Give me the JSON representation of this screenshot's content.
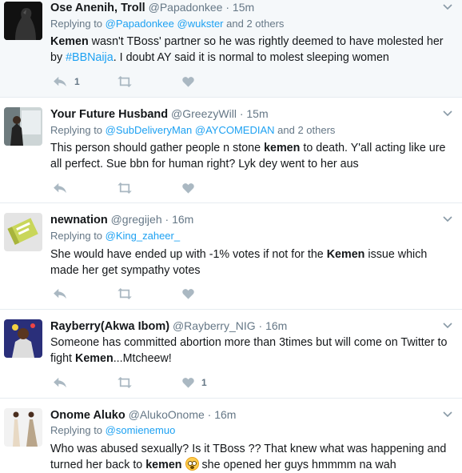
{
  "tweets": [
    {
      "name": "Ose Anenih, Troll",
      "handle": "@Papadonkee",
      "dot": "·",
      "time": "15m",
      "reply_prefix": "Replying to",
      "reply_users": [
        "@Papadonkee",
        "@wukster"
      ],
      "reply_suffix": "and 2 others",
      "text_kw": "Kemen",
      "text_a": " wasn't TBoss' partner so he was rightly deemed to have molested her by ",
      "text_tag": "#BBNaija",
      "text_b": ". I doubt AY said it is normal to molest sleeping women",
      "reply_count": "1",
      "like_count": ""
    },
    {
      "name": "Your Future Husband",
      "handle": "@GreezyWill",
      "dot": "·",
      "time": "15m",
      "reply_prefix": "Replying to",
      "reply_users": [
        "@SubDeliveryMan",
        "@AYCOMEDIAN"
      ],
      "reply_suffix": "and 2 others",
      "text_a": "This person should gather people n stone ",
      "text_kw": "kemen",
      "text_b": " to death. Y'all acting like ure all perfect. Sue bbn for human right? Lyk dey went to her aus"
    },
    {
      "name": "newnation",
      "handle": "@gregijeh",
      "dot": "·",
      "time": "16m",
      "reply_prefix": "Replying to",
      "reply_users": [
        "@King_zaheer_"
      ],
      "text_a": "She would have ended up with -1% votes if not for the ",
      "text_kw": "Kemen",
      "text_b": " issue which made her get sympathy votes"
    },
    {
      "name": "Rayberry(Akwa Ibom)",
      "handle": "@Rayberry_NIG",
      "dot": "·",
      "time": "16m",
      "text_a": "Someone has committed abortion more than 3times but will come on Twitter to fight ",
      "text_kw": "Kemen",
      "text_b": "...Mtcheew!",
      "like_count": "1"
    },
    {
      "name": "Onome Aluko",
      "handle": "@AlukoOnome",
      "dot": "·",
      "time": "16m",
      "reply_prefix": "Replying to",
      "reply_users": [
        "@somienemuo"
      ],
      "text_a": "Who was abused sexually? Is it TBoss ?? That knew what was happening and turned her back to ",
      "text_kw": "kemen",
      "text_b": " she opened her guys hmmmm na wah",
      "emoji": "flushed-face-emoji"
    }
  ],
  "icons": {
    "reply": "reply-icon",
    "retweet": "retweet-icon",
    "like": "heart-icon",
    "more": "chevron-down-icon"
  },
  "colors": {
    "link": "#1da1f2",
    "muted": "#657786",
    "icon": "#aab8c2",
    "highlight_bg": "#f5f8fa"
  }
}
